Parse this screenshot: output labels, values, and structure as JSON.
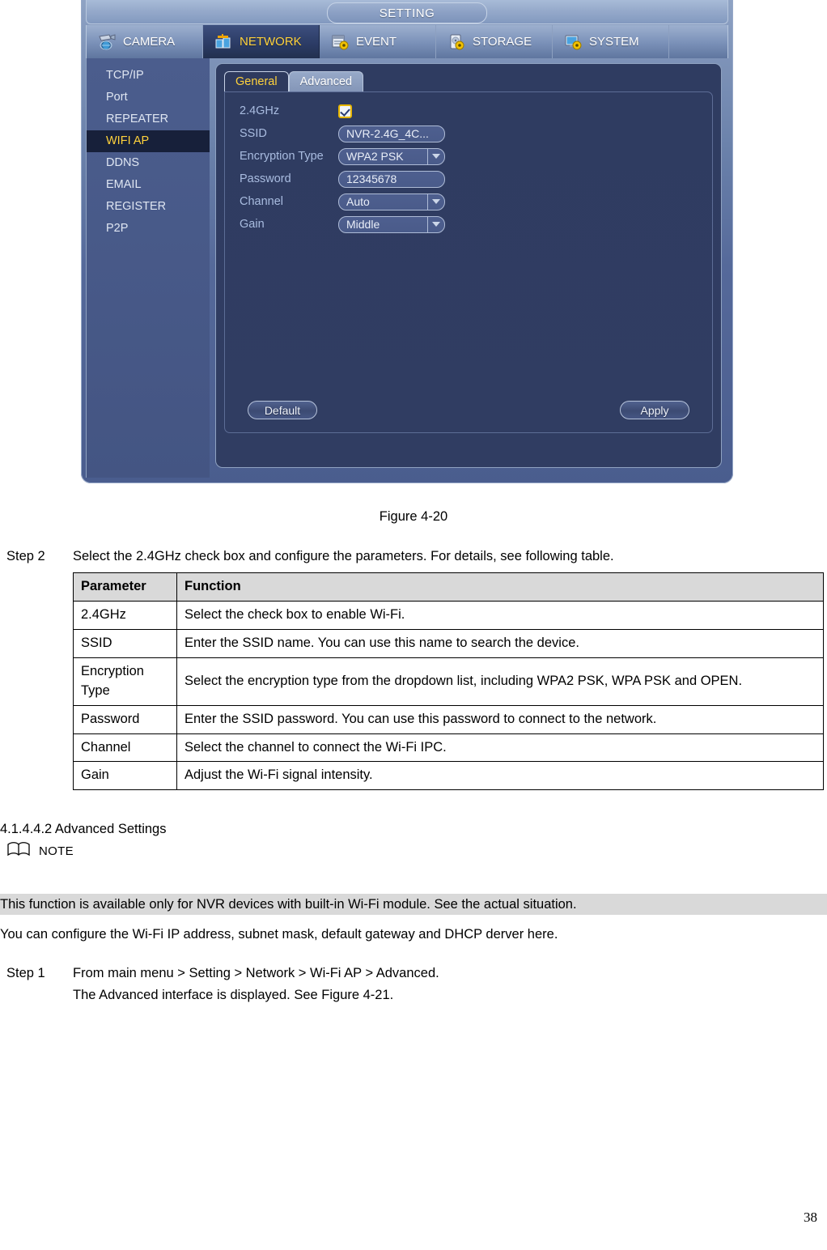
{
  "nvr": {
    "title": "SETTING",
    "menu": [
      {
        "label": "CAMERA",
        "icon": "camera-icon",
        "active": false
      },
      {
        "label": "NETWORK",
        "icon": "network-icon",
        "active": true
      },
      {
        "label": "EVENT",
        "icon": "event-icon",
        "active": false
      },
      {
        "label": "STORAGE",
        "icon": "storage-icon",
        "active": false
      },
      {
        "label": "SYSTEM",
        "icon": "system-icon",
        "active": false
      }
    ],
    "sidebar": [
      {
        "label": "TCP/IP",
        "active": false
      },
      {
        "label": "Port",
        "active": false
      },
      {
        "label": "REPEATER",
        "active": false
      },
      {
        "label": "WIFI AP",
        "active": true
      },
      {
        "label": "DDNS",
        "active": false
      },
      {
        "label": "EMAIL",
        "active": false
      },
      {
        "label": "REGISTER",
        "active": false
      },
      {
        "label": "P2P",
        "active": false
      }
    ],
    "tabs": [
      {
        "label": "General",
        "active": true
      },
      {
        "label": "Advanced",
        "active": false
      }
    ],
    "form": {
      "ghz_label": "2.4GHz",
      "ghz_checked": true,
      "ssid_label": "SSID",
      "ssid_value": "NVR-2.4G_4C...",
      "encryption_label": "Encryption Type",
      "encryption_value": "WPA2 PSK",
      "password_label": "Password",
      "password_value": "12345678",
      "channel_label": "Channel",
      "channel_value": "Auto",
      "gain_label": "Gain",
      "gain_value": "Middle"
    },
    "buttons": {
      "default": "Default",
      "apply": "Apply"
    },
    "colors": {
      "accent_yellow": "#ffd23c",
      "panel_blue": "#303d62",
      "active_menu": "#2c3c66",
      "checkbox_border": "#e8b600"
    }
  },
  "doc": {
    "figure_caption": "Figure 4-20",
    "step2_label": "Step 2",
    "step2_text": "Select the 2.4GHz check box and configure the parameters. For details, see following table.",
    "table": {
      "headers": [
        "Parameter",
        "Function"
      ],
      "rows": [
        {
          "parameter": "2.4GHz",
          "function": "Select the check box to enable Wi-Fi."
        },
        {
          "parameter": "SSID",
          "function": "Enter the SSID name. You can use this name to search the device."
        },
        {
          "parameter": "Encryption Type",
          "function": "Select the encryption type from the dropdown list, including WPA2 PSK, WPA PSK and OPEN."
        },
        {
          "parameter": "Password",
          "function": "Enter the SSID password. You can use this password to connect to the network."
        },
        {
          "parameter": "Channel",
          "function": "Select the channel to connect the Wi-Fi IPC."
        },
        {
          "parameter": "Gain",
          "function": "Adjust the Wi-Fi signal intensity."
        }
      ]
    },
    "section_heading": "4.1.4.4.2   Advanced Settings",
    "note_label": "NOTE",
    "note_body": "This function is available only for NVR devices with built-in Wi-Fi module. See the actual situation.",
    "paragraph_1": "You can configure the Wi-Fi IP address, subnet mask, default gateway and DHCP derver here.",
    "step1_label": "Step 1",
    "step1_text": "From main menu > Setting > Network > Wi-Fi AP > Advanced.",
    "step1_sub": "The Advanced interface is displayed. See Figure 4-21.",
    "page_number": "38"
  }
}
